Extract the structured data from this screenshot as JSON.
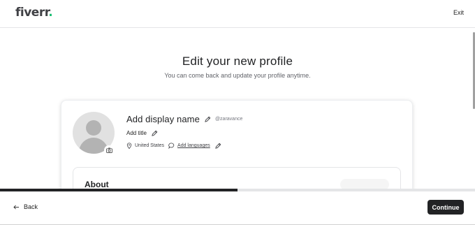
{
  "header": {
    "logo_text": "fiverr",
    "logo_dot": ".",
    "exit_label": "Exit"
  },
  "main": {
    "title": "Edit your new profile",
    "subtitle": "You can come back and update your profile anytime."
  },
  "profile": {
    "display_name": "Add display name",
    "username": "@zaravance",
    "title": "Add title",
    "location": "United States",
    "languages_link": "Add languages"
  },
  "about": {
    "title": "About"
  },
  "progress": {
    "fraction": 0.5
  },
  "footer": {
    "back_label": "Back",
    "continue_label": "Continue"
  },
  "colors": {
    "brand_green": "#1dbf73",
    "primary_dark": "#222325"
  },
  "icons": [
    "pencil-icon",
    "camera-icon",
    "location-pin-icon",
    "speech-bubble-icon",
    "arrow-left-icon"
  ]
}
